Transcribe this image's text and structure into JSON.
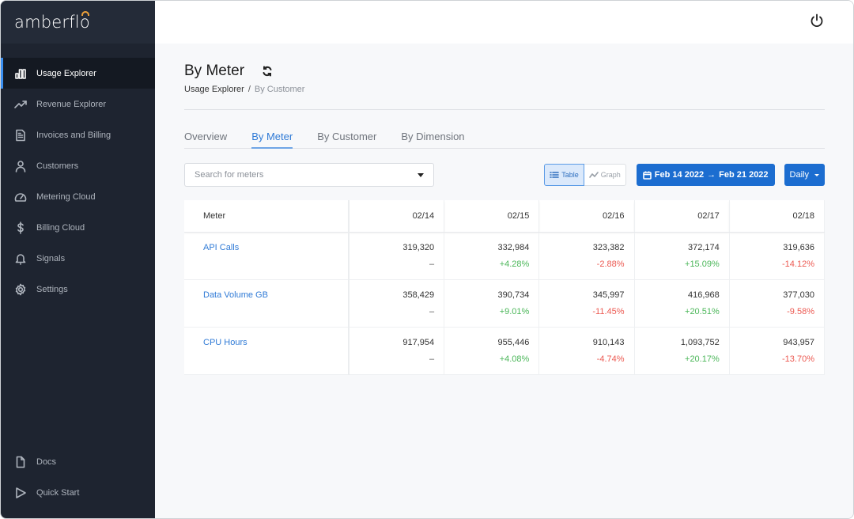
{
  "app": {
    "logo": "amberflo",
    "accent_color": "#1c6dd0",
    "positive_color": "#4cb75a",
    "negative_color": "#ec5a52"
  },
  "sidebar": {
    "items": [
      {
        "label": "Usage Explorer",
        "icon": "bar-chart-icon",
        "active": true
      },
      {
        "label": "Revenue Explorer",
        "icon": "trending-up-icon"
      },
      {
        "label": "Invoices and Billing",
        "icon": "document-icon"
      },
      {
        "label": "Customers",
        "icon": "user-icon"
      },
      {
        "label": "Metering Cloud",
        "icon": "gauge-icon"
      },
      {
        "label": "Billing Cloud",
        "icon": "dollar-icon"
      },
      {
        "label": "Signals",
        "icon": "bell-icon"
      },
      {
        "label": "Settings",
        "icon": "gear-icon"
      }
    ],
    "bottom_items": [
      {
        "label": "Docs",
        "icon": "file-icon"
      },
      {
        "label": "Quick Start",
        "icon": "play-icon"
      }
    ]
  },
  "topbar": {
    "power_icon": "power-icon"
  },
  "header": {
    "title": "By Meter",
    "breadcrumb": {
      "parent": "Usage Explorer",
      "separator": "/",
      "current": "By Customer"
    }
  },
  "tabs": [
    {
      "label": "Overview"
    },
    {
      "label": "By Meter",
      "active": true
    },
    {
      "label": "By Customer"
    },
    {
      "label": "By Dimension"
    }
  ],
  "toolbar": {
    "search_placeholder": "Search for meters",
    "search_value": "",
    "view_table_label": "Table",
    "view_graph_label": "Graph",
    "date_from": "Feb 14 2022",
    "date_arrow": "→",
    "date_to": "Feb 21 2022",
    "interval": "Daily"
  },
  "table": {
    "columns": [
      "Meter",
      "02/14",
      "02/15",
      "02/16",
      "02/17",
      "02/18"
    ],
    "rows": [
      {
        "meter": "API Calls",
        "values": [
          "319,320",
          "332,984",
          "323,382",
          "372,174",
          "319,636"
        ],
        "changes": [
          "–",
          "+4.28%",
          "-2.88%",
          "+15.09%",
          "-14.12%"
        ],
        "trend": [
          "none",
          "up",
          "down",
          "up",
          "down"
        ]
      },
      {
        "meter": "Data Volume GB",
        "values": [
          "358,429",
          "390,734",
          "345,997",
          "416,968",
          "377,030"
        ],
        "changes": [
          "–",
          "+9.01%",
          "-11.45%",
          "+20.51%",
          "-9.58%"
        ],
        "trend": [
          "none",
          "up",
          "down",
          "up",
          "down"
        ]
      },
      {
        "meter": "CPU Hours",
        "values": [
          "917,954",
          "955,446",
          "910,143",
          "1,093,752",
          "943,957"
        ],
        "changes": [
          "–",
          "+4.08%",
          "-4.74%",
          "+20.17%",
          "-13.70%"
        ],
        "trend": [
          "none",
          "up",
          "down",
          "up",
          "down"
        ]
      }
    ]
  }
}
